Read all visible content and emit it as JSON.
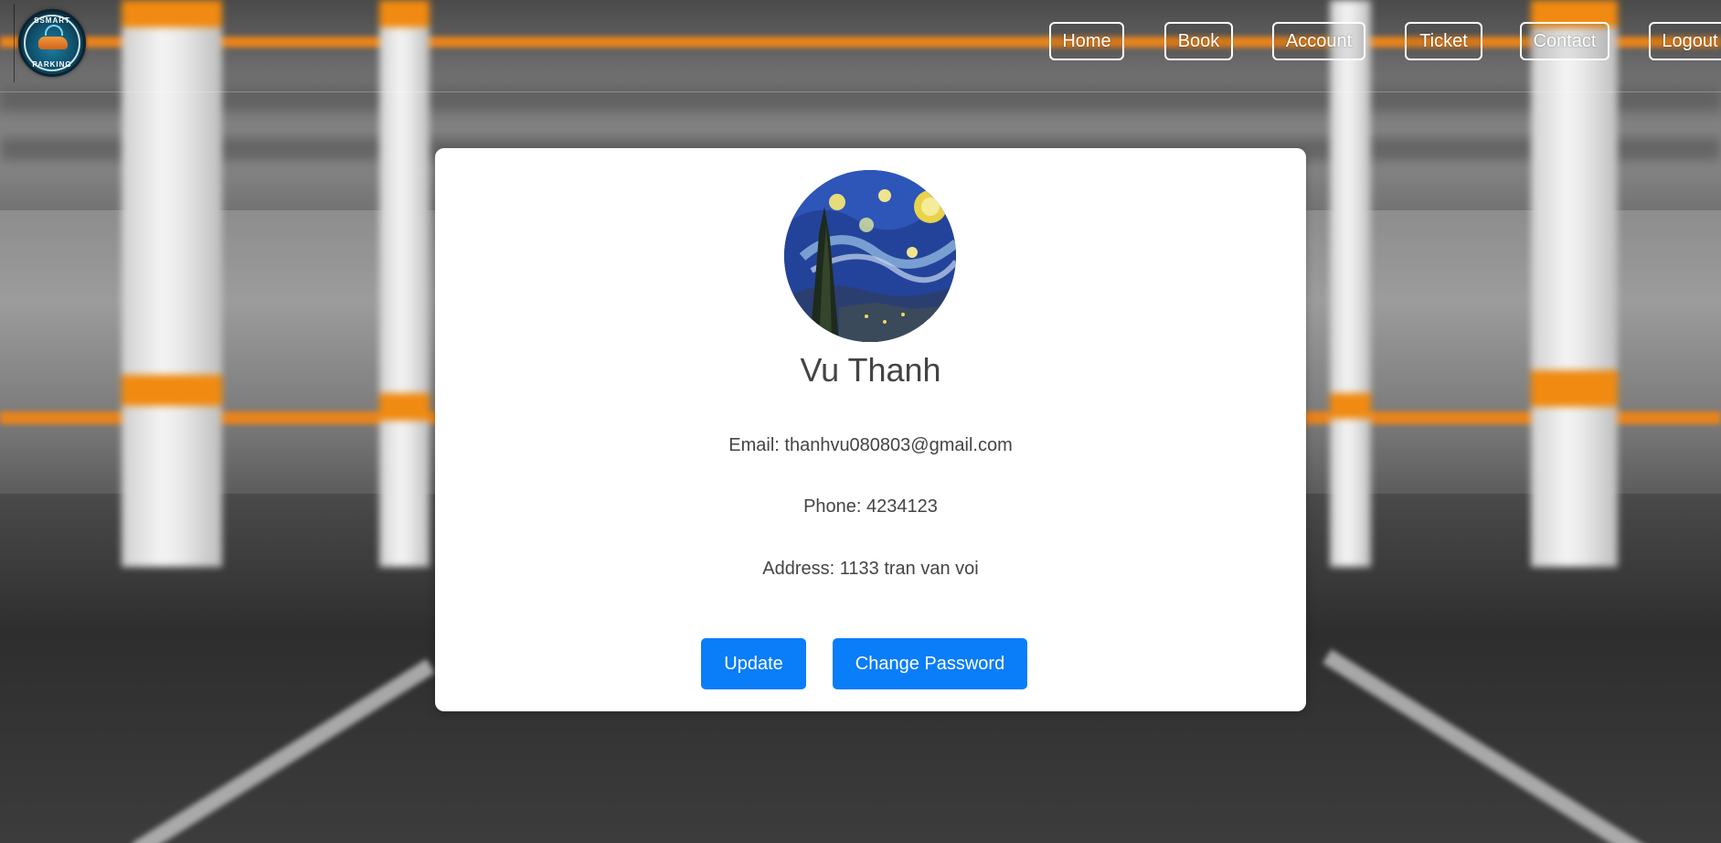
{
  "logo": {
    "text_top": "SSMART",
    "text_bottom": "PARKING",
    "accent": "#e8831c"
  },
  "nav": {
    "items": [
      {
        "label": "Home"
      },
      {
        "label": "Book"
      },
      {
        "label": "Account"
      },
      {
        "label": "Ticket"
      },
      {
        "label": "Contact"
      },
      {
        "label": "Logout"
      }
    ]
  },
  "profile": {
    "name": "Vu Thanh",
    "email": "Email: thanhvu080803@gmail.com",
    "phone": "Phone: 4234123",
    "address": "Address: 1133 tran van voi",
    "avatar_icon": "starry-night-painting"
  },
  "actions": {
    "update_label": "Update",
    "change_password_label": "Change Password",
    "button_color": "#0a7df8"
  }
}
